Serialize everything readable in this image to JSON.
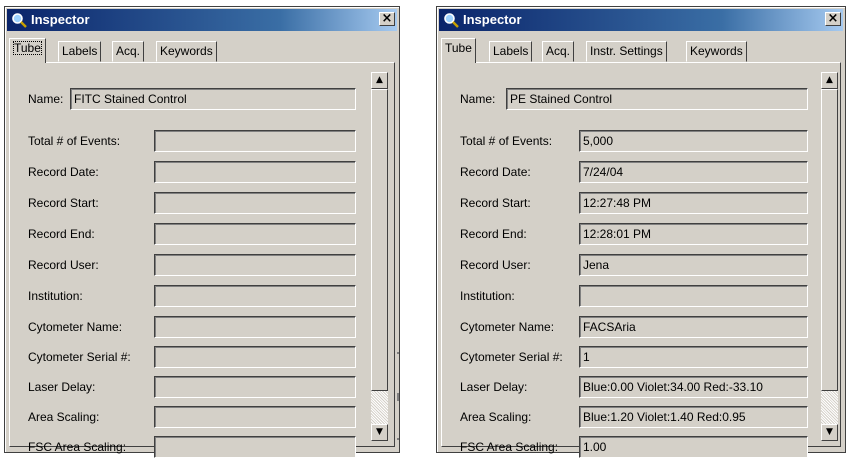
{
  "windows": [
    {
      "title": "Inspector",
      "tabs": [
        "Tube",
        "Labels",
        "Acq.",
        "Keywords"
      ],
      "name_label": "Name:",
      "name_value": "FITC Stained Control",
      "fields": [
        {
          "label": "Total # of Events:",
          "value": ""
        },
        {
          "label": "Record Date:",
          "value": ""
        },
        {
          "label": "Record Start:",
          "value": ""
        },
        {
          "label": "Record End:",
          "value": ""
        },
        {
          "label": "Record User:",
          "value": ""
        },
        {
          "label": "Institution:",
          "value": ""
        },
        {
          "label": "Cytometer Name:",
          "value": ""
        },
        {
          "label": "Cytometer Serial #:",
          "value": ""
        },
        {
          "label": "Laser Delay:",
          "value": ""
        },
        {
          "label": "Area Scaling:",
          "value": ""
        },
        {
          "label": "FSC Area Scaling:",
          "value": ""
        }
      ]
    },
    {
      "title": "Inspector",
      "tabs": [
        "Tube",
        "Labels",
        "Acq.",
        "Instr. Settings",
        "Keywords"
      ],
      "name_label": "Name:",
      "name_value": "PE Stained Control",
      "fields": [
        {
          "label": "Total # of Events:",
          "value": "5,000"
        },
        {
          "label": "Record Date:",
          "value": "7/24/04"
        },
        {
          "label": "Record Start:",
          "value": "12:27:48 PM"
        },
        {
          "label": "Record End:",
          "value": "12:28:01 PM"
        },
        {
          "label": "Record User:",
          "value": "Jena"
        },
        {
          "label": "Institution:",
          "value": ""
        },
        {
          "label": "Cytometer Name:",
          "value": "FACSAria"
        },
        {
          "label": "Cytometer Serial #:",
          "value": "1"
        },
        {
          "label": "Laser Delay:",
          "value": "Blue:0.00  Violet:34.00  Red:-33.10"
        },
        {
          "label": "Area Scaling:",
          "value": "Blue:1.20  Violet:1.40  Red:0.95"
        },
        {
          "label": "FSC Area Scaling:",
          "value": "1.00"
        }
      ]
    }
  ],
  "icons": {
    "title": "magnifier-icon",
    "close": "close-icon",
    "scroll_up": "scroll-up-arrow-icon",
    "scroll_down": "scroll-down-arrow-icon"
  },
  "colors": {
    "titlebar_start": "#0a246a",
    "titlebar_end": "#a6caf0",
    "face": "#d4d0c8"
  }
}
